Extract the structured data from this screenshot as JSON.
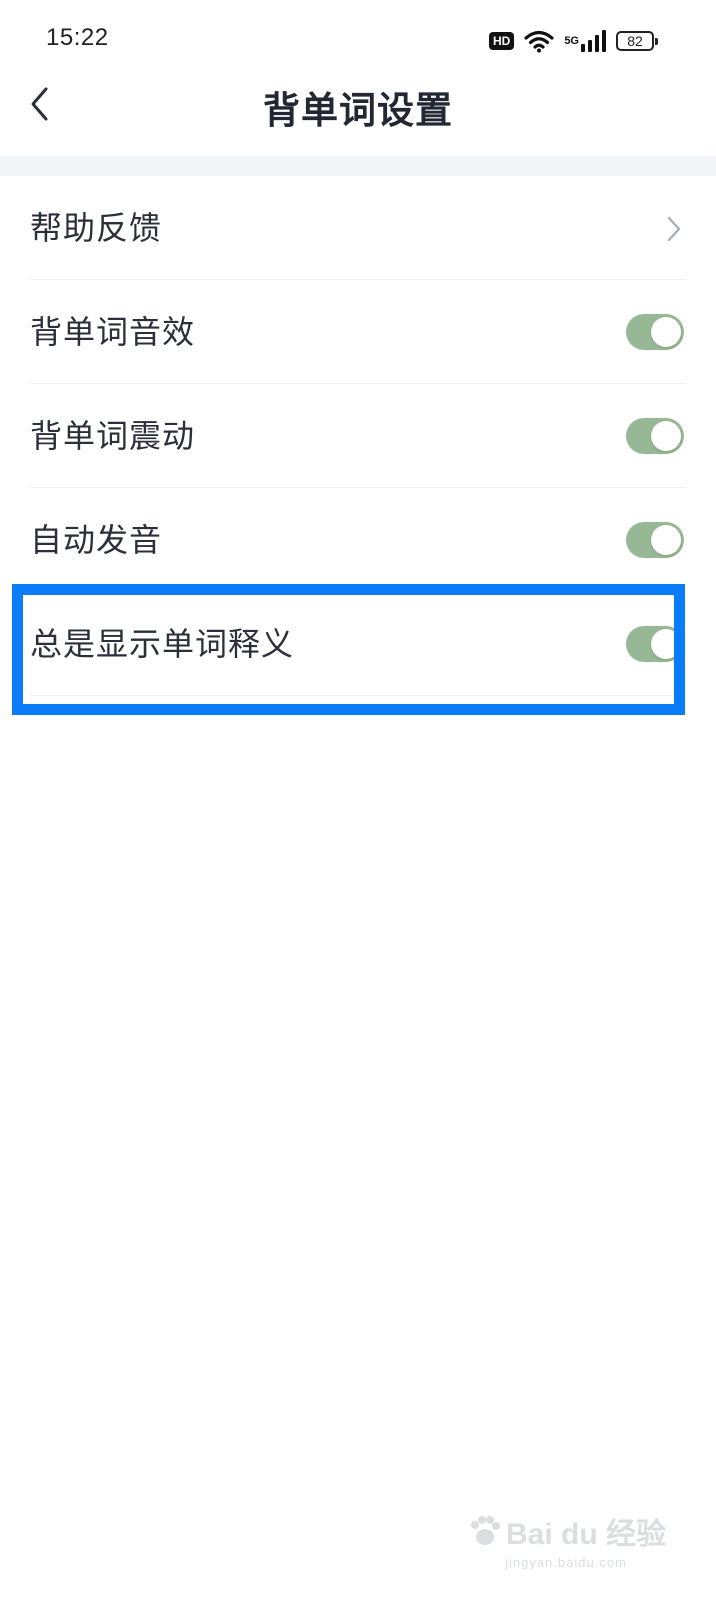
{
  "status_bar": {
    "time": "15:22",
    "hd_badge": "HD",
    "network": "5G",
    "battery": "82"
  },
  "header": {
    "title": "背单词设置",
    "back_icon": "chevron-left-icon"
  },
  "settings": {
    "items": [
      {
        "label": "帮助反馈",
        "control": "chevron",
        "icon": "chevron-right-icon"
      },
      {
        "label": "背单词音效",
        "control": "toggle",
        "enabled": true
      },
      {
        "label": "背单词震动",
        "control": "toggle",
        "enabled": true
      },
      {
        "label": "自动发音",
        "control": "toggle",
        "enabled": true
      },
      {
        "label": "总是显示单词释义",
        "control": "toggle",
        "enabled": true
      }
    ]
  },
  "watermark": {
    "brand": "Bai du 经验",
    "url": "jingyan.baidu.com"
  },
  "colors": {
    "toggle_on": "#96b894",
    "highlight": "#0a7cf7",
    "title": "#222733"
  }
}
